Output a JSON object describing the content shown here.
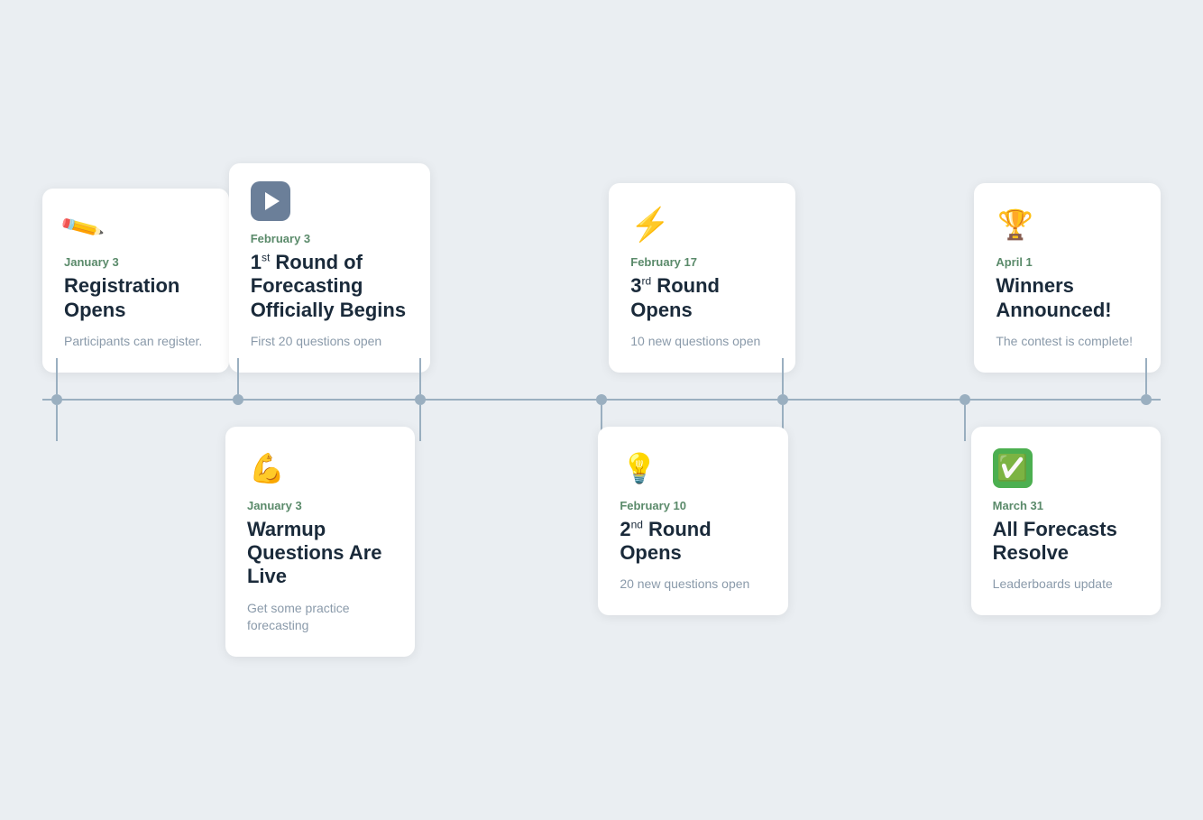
{
  "timeline": {
    "top_cards": [
      {
        "id": "registration",
        "icon": "✏️",
        "icon_type": "pencil",
        "date": "January 3",
        "title_html": "Registration Opens",
        "description": "Participants can register."
      },
      {
        "id": "round1",
        "icon": "▶",
        "icon_type": "play",
        "date": "February 3",
        "title_html": "1<sup>st</sup> Round of Forecasting Officially Begins",
        "description": "First 20 questions open"
      },
      {
        "id": "round3",
        "icon": "⚡",
        "icon_type": "emoji",
        "date": "February 17",
        "title_html": "3<sup>rd</sup> Round Opens",
        "description": "10 new questions open"
      },
      {
        "id": "winners",
        "icon": "🏆",
        "icon_type": "emoji",
        "date": "April 1",
        "title_html": "Winners Announced!",
        "description": "The contest is complete!"
      }
    ],
    "bottom_cards": [
      {
        "id": "warmup",
        "icon": "💪",
        "icon_type": "emoji",
        "date": "January 3",
        "title_html": "Warmup Questions Are Live",
        "description": "Get some practice forecasting"
      },
      {
        "id": "round2",
        "icon": "💡",
        "icon_type": "emoji",
        "date": "February 10",
        "title_html": "2<sup>nd</sup> Round Opens",
        "description": "20 new questions open"
      },
      {
        "id": "resolve",
        "icon": "✅",
        "icon_type": "emoji-green",
        "date": "March 31",
        "title_html": "All Forecasts Resolve",
        "description": "Leaderboards update"
      }
    ],
    "dots_count": 7
  }
}
